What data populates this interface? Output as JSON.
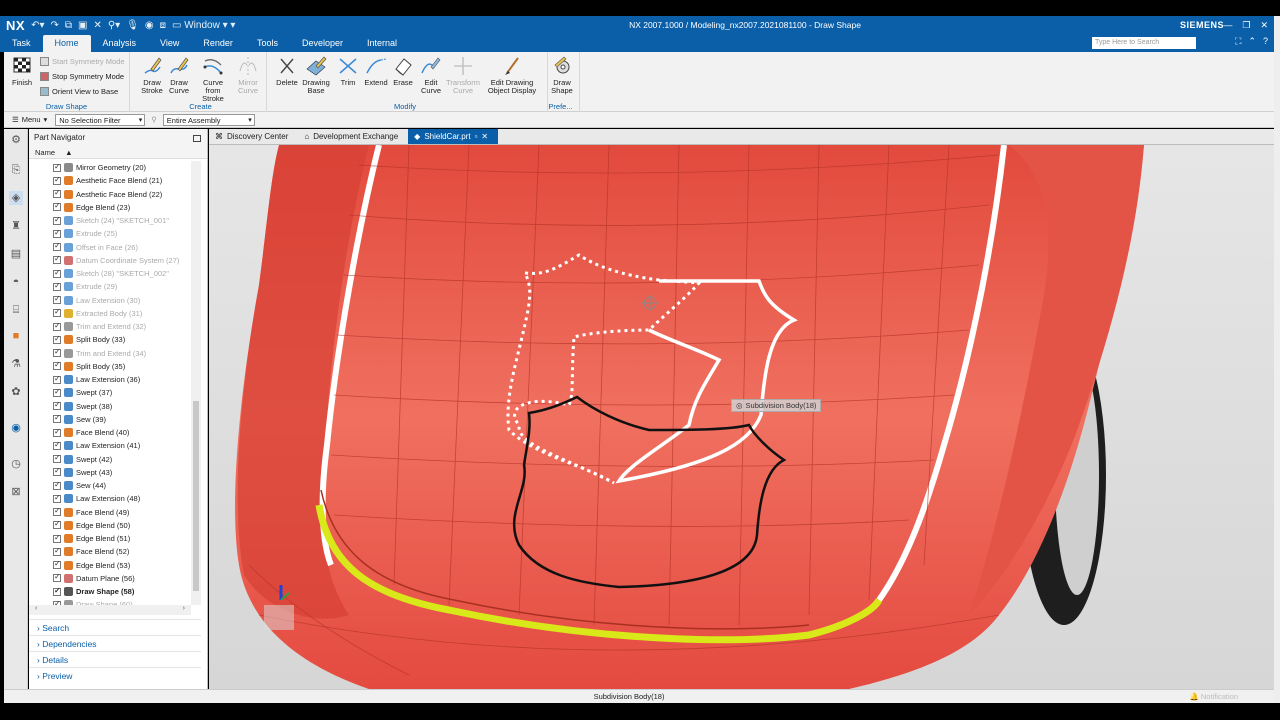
{
  "titlebar": {
    "logo": "NX",
    "window_menu": "Window",
    "title": "NX 2007.1000 / Modeling_nx2007.2021081100 - Draw Shape",
    "brand": "SIEMENS"
  },
  "menu_tabs": [
    "Task",
    "Home",
    "Analysis",
    "View",
    "Render",
    "Tools",
    "Developer",
    "Internal"
  ],
  "active_tab": "Home",
  "search": {
    "placeholder": "Type Here to Search"
  },
  "ribbon": {
    "draw_shape_group": {
      "title": "Draw Shape",
      "finish": "Finish",
      "start_symmetry": "Start Symmetry Mode",
      "stop_symmetry": "Stop Symmetry Mode",
      "orient_view": "Orient View to Base"
    },
    "create_group": {
      "title": "Create",
      "draw_stroke": [
        "Draw",
        "Stroke"
      ],
      "draw_curve": [
        "Draw",
        "Curve"
      ],
      "curve_from_stroke": [
        "Curve from",
        "Stroke"
      ],
      "mirror_curve": [
        "Mirror",
        "Curve"
      ],
      "drawing_base": [
        "Drawing",
        "Base"
      ]
    },
    "modify_group": {
      "title": "Modify",
      "delete": "Delete",
      "trim": "Trim",
      "extend": "Extend",
      "erase": "Erase",
      "edit_curve": [
        "Edit",
        "Curve"
      ],
      "transform_curve": [
        "Transform",
        "Curve"
      ],
      "edit_drawing_display": [
        "Edit Drawing",
        "Object Display"
      ]
    },
    "pref_group": {
      "title": "Prefe...",
      "draw_shape": [
        "Draw",
        "Shape"
      ]
    }
  },
  "filterbar": {
    "menu": "Menu",
    "selection_filter": "No Selection Filter",
    "assembly_scope": "Entire Assembly"
  },
  "part_navigator": {
    "title": "Part Navigator",
    "column": "Name",
    "items": [
      {
        "label": "Mirror Geometry (20)",
        "dim": false,
        "color": "#8a8a8a"
      },
      {
        "label": "Aesthetic Face Blend (21)",
        "dim": false,
        "color": "#e07b2a"
      },
      {
        "label": "Aesthetic Face Blend (22)",
        "dim": false,
        "color": "#e07b2a"
      },
      {
        "label": "Edge Blend (23)",
        "dim": false,
        "color": "#e07b2a"
      },
      {
        "label": "Sketch (24) \"SKETCH_001\"",
        "dim": true,
        "color": "#6aa0d8"
      },
      {
        "label": "Extrude (25)",
        "dim": true,
        "color": "#6aa0d8"
      },
      {
        "label": "Offset in Face (26)",
        "dim": true,
        "color": "#6aa0d8"
      },
      {
        "label": "Datum Coordinate System (27)",
        "dim": true,
        "color": "#d07070"
      },
      {
        "label": "Sketch (28) \"SKETCH_002\"",
        "dim": true,
        "color": "#6aa0d8"
      },
      {
        "label": "Extrude (29)",
        "dim": true,
        "color": "#6aa0d8"
      },
      {
        "label": "Law Extension (30)",
        "dim": true,
        "color": "#6aa0d8"
      },
      {
        "label": "Extracted Body (31)",
        "dim": true,
        "color": "#e0b030"
      },
      {
        "label": "Trim and Extend (32)",
        "dim": true,
        "color": "#999999"
      },
      {
        "label": "Split Body (33)",
        "dim": false,
        "color": "#e07b2a"
      },
      {
        "label": "Trim and Extend (34)",
        "dim": true,
        "color": "#999999"
      },
      {
        "label": "Split Body (35)",
        "dim": false,
        "color": "#e07b2a"
      },
      {
        "label": "Law Extension (36)",
        "dim": false,
        "color": "#4a8ac8"
      },
      {
        "label": "Swept (37)",
        "dim": false,
        "color": "#4a8ac8"
      },
      {
        "label": "Swept (38)",
        "dim": false,
        "color": "#4a8ac8"
      },
      {
        "label": "Sew (39)",
        "dim": false,
        "color": "#4a8ac8"
      },
      {
        "label": "Face Blend (40)",
        "dim": false,
        "color": "#e07b2a"
      },
      {
        "label": "Law Extension (41)",
        "dim": false,
        "color": "#4a8ac8"
      },
      {
        "label": "Swept (42)",
        "dim": false,
        "color": "#4a8ac8"
      },
      {
        "label": "Swept (43)",
        "dim": false,
        "color": "#4a8ac8"
      },
      {
        "label": "Sew (44)",
        "dim": false,
        "color": "#4a8ac8"
      },
      {
        "label": "Law Extension (48)",
        "dim": false,
        "color": "#4a8ac8"
      },
      {
        "label": "Face Blend (49)",
        "dim": false,
        "color": "#e07b2a"
      },
      {
        "label": "Edge Blend (50)",
        "dim": false,
        "color": "#e07b2a"
      },
      {
        "label": "Edge Blend (51)",
        "dim": false,
        "color": "#e07b2a"
      },
      {
        "label": "Face Blend (52)",
        "dim": false,
        "color": "#e07b2a"
      },
      {
        "label": "Edge Blend (53)",
        "dim": false,
        "color": "#e07b2a"
      },
      {
        "label": "Datum Plane (56)",
        "dim": false,
        "color": "#d07070"
      },
      {
        "label": "Draw Shape (58)",
        "dim": false,
        "bold": true,
        "color": "#555555"
      },
      {
        "label": "Draw Shape (60)",
        "dim": true,
        "color": "#999999"
      }
    ],
    "sections": [
      "Search",
      "Dependencies",
      "Details",
      "Preview"
    ]
  },
  "doc_tabs": [
    "Discovery Center",
    "Development Exchange",
    "ShieldCar.prt"
  ],
  "active_doc_tab": "ShieldCar.prt",
  "viewport": {
    "tooltip": "Subdivision Body(18)"
  },
  "status": {
    "text": "Subdivision Body(18)",
    "notification": "Notification"
  },
  "colors": {
    "nx_blue": "#0a5fa8",
    "body_red": "#e8564a",
    "highlight_yellow": "#d8e818"
  }
}
